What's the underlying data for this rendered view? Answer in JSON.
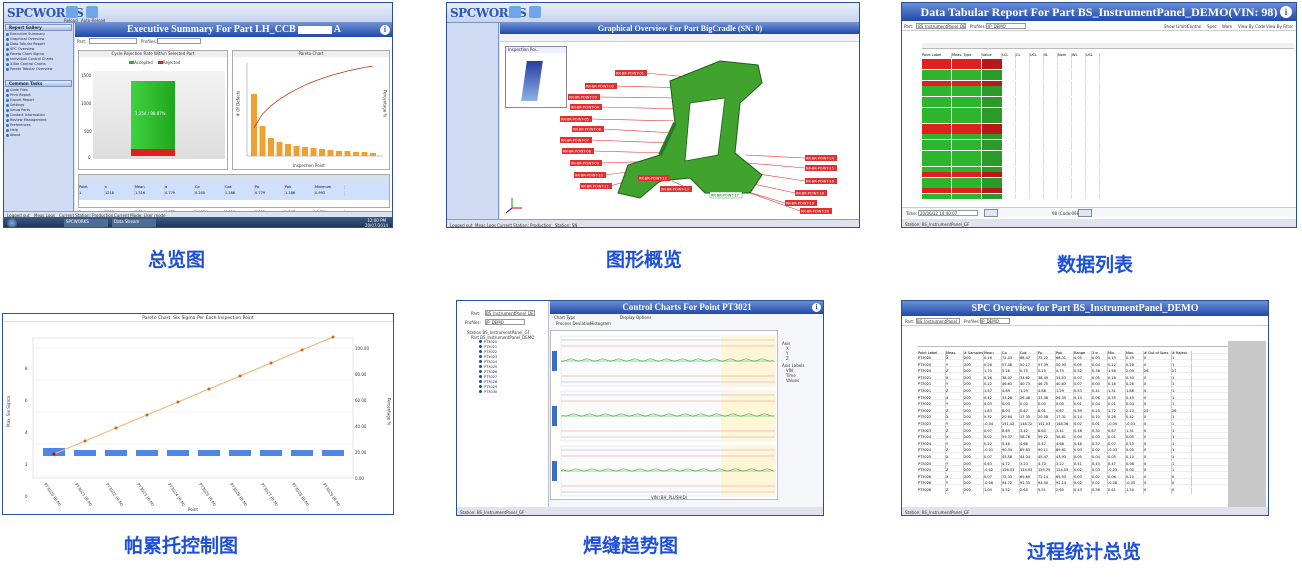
{
  "captions": [
    "总览图",
    "图形概览",
    "数据列表",
    "帕累托控制图",
    "焊缝趋势图",
    "过程统计总览"
  ],
  "logo_text": "SPCWORKS",
  "colors": {
    "caption": "#1d4fd8",
    "title_bar": "#2b56b5",
    "green": "#2db52d",
    "red": "#e02020",
    "orange": "#f08a1a",
    "blue_bar": "#4d86e6"
  },
  "tile1": {
    "title": "Executive Summary For Part LH_CCB",
    "title_suffix": "A",
    "toolbar": [
      "Reload",
      "Auto-Reload"
    ],
    "part_label": "Part:",
    "profiles_label": "Profiles:",
    "report_gallery": "Report Gallery",
    "side_items": [
      "Executive Summary",
      "Graphical Overview",
      "Data Tabular Report",
      "SPC Overview",
      "Pareto Chart Sigma",
      "Individual Control Charts",
      "X-Bar Control Charts",
      "Pareto Tabular Overview"
    ],
    "common_tasks": "Common Tasks",
    "task_items": [
      "Code Files",
      "Print Report",
      "Export Report",
      "Settings",
      "Setup Parts",
      "Contact Information",
      "Review Management",
      "Preferences",
      "Help",
      "About"
    ],
    "chart1_title": "Cycle Rejection Rate Within Selected Part",
    "chart1_legend": [
      "Accepted",
      "Rejected"
    ],
    "chart1_label": "1,254 / 98.87%",
    "chart2_title": "Pareto Chart",
    "chart2_ylabel": "# Of Defects",
    "chart2_xlabel": "Inspection Point",
    "chart2_right": "Percentage %",
    "y_ticks": [
      "1500",
      "1000",
      "500",
      "0"
    ],
    "table_headers": [
      "Point",
      "n",
      "Mean",
      "σ",
      "Cp",
      "Cpk",
      "Pp",
      "Ppk",
      "Minimum"
    ],
    "table_rows": [
      [
        "1",
        "1218",
        "1.316",
        "0.779",
        "0.200",
        "1.186",
        "0.779",
        "1.186",
        "0.993"
      ],
      [
        "2",
        "1218",
        "1.754",
        "0.475",
        "0.418",
        "1.416",
        "0.495",
        "1.367",
        "-0.009"
      ]
    ],
    "status": [
      "Logged out",
      "Meas Logs",
      "Current Station: Production",
      "Current Mode: User mode"
    ],
    "taskbar": [
      "SPCWORKS",
      "Data Stream"
    ],
    "clock": [
      "12:00 PM",
      "20/07/2014"
    ]
  },
  "tile2": {
    "title": "Graphical Overview For Part BigCradle (SN: 0)",
    "toolbar": [
      "Reload",
      "Auto-Reload"
    ],
    "part_label": "Part:",
    "part_value": "BigCradle",
    "profile_value": "SN",
    "popup_title": "Inspection Poi...",
    "labels_left": [
      "RR-BR-POINT-01",
      "RR-BR-POINT-02",
      "RR-BR-POINT-03",
      "RR-BR-POINT-04",
      "RR-BR-POINT-05",
      "RR-BR-POINT-06",
      "RR-BR-POINT-07",
      "RR-BR-POINT-08",
      "RR-BR-POINT-09",
      "RR-BR-POINT-10",
      "RR-BR-POINT-11",
      "RR-BR-POINT-12",
      "RR-BR-POINT-13"
    ],
    "labels_right": [
      "RR-BR-POINT-14",
      "RR-BR-POINT-15",
      "RR-BR-POINT-16",
      "RR-BR-POINT-17",
      "RR-BR-POINT-18",
      "RR-BR-POINT-19",
      "RR-BR-POINT-20"
    ],
    "status": [
      "Logged out",
      "Meas Logs",
      "Current Station: Production",
      "Station: SN"
    ]
  },
  "tile3": {
    "title": "Data Tabular Report For Part BS_InstrumentPanel_DEMO(VIN: 98)",
    "part_label": "Part:",
    "part_value": "BS_InstrumentPanel_DEMO",
    "profiles_label": "Profiles:",
    "profiles_value": "IP_DEMO",
    "show_limits": "Show Limits",
    "checks": [
      "Control",
      "Spec",
      "Warn"
    ],
    "view_by": [
      "View By Code",
      "View By Filter"
    ],
    "headers": [
      "Point Label",
      "Meas. Type",
      "Value",
      "LCL",
      "CL",
      "UCL",
      "SL",
      "Nom",
      "WL",
      "USL"
    ],
    "row_statuses": [
      "r",
      "r",
      "g",
      "g",
      "r",
      "g",
      "g",
      "g",
      "g",
      "g",
      "g",
      "g",
      "r",
      "r",
      "g",
      "g",
      "g",
      "g",
      "g",
      "g",
      "g",
      "r",
      "g",
      "g",
      "r",
      "g"
    ],
    "time_label": "Time:",
    "time_value": "20/06/12 14:40:07",
    "vin_label": "98 (Code:098)",
    "status": "Station: BS_InstrumentPanel_GF"
  },
  "tile4": {
    "title": "Pareto Chart: Six Sigma Per Each Inspection Point",
    "legend": [
      "Max. Six Sigma",
      "Cumulative Pareto Line"
    ],
    "xlabel": "Point",
    "ylabel_left": "Max. Six Sigma",
    "ylabel_right": "Percentage %",
    "y_ticks": [
      "8",
      "6",
      "4",
      "2",
      "0"
    ],
    "right_ticks": [
      "100.00",
      "80.00",
      "60.00",
      "40.00",
      "20.00",
      "0.00"
    ],
    "points": [
      "PT3020 (R-M)",
      "PT3021 (R-M)",
      "PT3022 (R-M)",
      "PT3023 (R-M)",
      "PT3024 (R-M)",
      "PT3025 (R-M)",
      "PT3026 (R-M)",
      "PT3027 (R-M)",
      "PT3028 (R-M)",
      "PT3029 (R-M)"
    ]
  },
  "tile5": {
    "title": "Control Charts For Point PT3021",
    "part_label": "Part:",
    "part_value": "BS_InstrumentPanel_DEMO",
    "profiles_label": "Profiles:",
    "profiles_value": "IP_DEMO",
    "tree_root": "Station BS_InstrumentPanel_GF",
    "tree_part": "Part BS_InstrumentPanel_DEMO",
    "tree_points": [
      "PT3020",
      "PT3021",
      "PT3022",
      "PT3023",
      "PT3024",
      "PT3025",
      "PT3026",
      "PT3027",
      "PT3028",
      "PT3029",
      "PT3030"
    ],
    "chart_type_label": "Chart Type",
    "chart_types": [
      "Process Deviation",
      "Histogram"
    ],
    "display_label": "Display Options",
    "display_opts": [
      "Mean",
      "Std.Dev.",
      "Warn",
      "Spec",
      "Control",
      "Cp",
      "Cpk",
      "Pp",
      "Ppk",
      "Def Curve"
    ],
    "axis_label": "Axis",
    "axis_opts": [
      "X",
      "Y",
      "Z"
    ],
    "axis_labels_label": "Axis Labels",
    "axis_label_opts": [
      "VIN",
      "Time",
      "Values"
    ],
    "xlabel": "VIN (BH_PLUSHID)",
    "status": "Station: BS_InstrumentPanel_GF"
  },
  "tile6": {
    "title": "SPC Overview for Part BS_InstrumentPanel_DEMO",
    "part_label": "Part:",
    "part_value": "BS_InstrumentPanel_DEMO",
    "profiles_label": "Profiles:",
    "profiles_value": "IP_DEMO",
    "headers": [
      "Point Label",
      "Meas. Type",
      "# Samples",
      "Mean",
      "Cp",
      "Cpk",
      "Pp",
      "Ppk",
      "Range",
      "3 σ",
      "Min.",
      "Max.",
      "# Out of Spec",
      "# Reject"
    ],
    "rows": [
      [
        "PT3020",
        "X",
        "200",
        "0.16",
        "72.43",
        "68.47",
        "72.22",
        "66.31",
        "0.05",
        "0.03",
        "0.13",
        "0.19",
        "0",
        "1"
      ],
      [
        "PT3020",
        "Y",
        "200",
        "0.26",
        "57.48",
        "50.17",
        "57.39",
        "50.93",
        "0.05",
        "0.04",
        "0.22",
        "0.28",
        "0",
        "1"
      ],
      [
        "PT3020",
        "Z",
        "200",
        "1.70",
        "5.28",
        "0.75",
        "5.25",
        "0.75",
        "0.52",
        "0.38",
        "1.56",
        "2.09",
        "26",
        "27"
      ],
      [
        "PT3021",
        "X",
        "200",
        "0.26",
        "38.07",
        "34.62",
        "38.49",
        "34.53",
        "0.07",
        "0.05",
        "0.18",
        "0.30",
        "0",
        "1"
      ],
      [
        "PT3021",
        "Y",
        "200",
        "0.22",
        "46.63",
        "40.73",
        "46.75",
        "40.63",
        "0.07",
        "0.04",
        "0.18",
        "0.26",
        "0",
        "1"
      ],
      [
        "PT3021",
        "Z",
        "200",
        "1.47",
        "4.89",
        "1.29",
        "4.88",
        "1.29",
        "0.53",
        "0.41",
        "1.31",
        "1.86",
        "0",
        "1"
      ],
      [
        "PT3022",
        "X",
        "200",
        "0.42",
        "33.28",
        "26.48",
        "33.38",
        "26.35",
        "0.10",
        "0.06",
        "0.35",
        "0.49",
        "0",
        "1"
      ],
      [
        "PT3022",
        "Y",
        "200",
        "0.03",
        "0.00",
        "0.00",
        "0.00",
        "0.00",
        "0.01",
        "0.04",
        "0.01",
        "0.04",
        "0",
        "1"
      ],
      [
        "PT3022",
        "Z",
        "200",
        "1.83",
        "8.03",
        "0.67",
        "8.01",
        "0.67",
        "0.39",
        "0.25",
        "1.72",
        "2.10",
        "25",
        "26"
      ],
      [
        "PT3023",
        "X",
        "200",
        "0.32",
        "20.64",
        "17.35",
        "20.58",
        "17.31",
        "0.14",
        "0.10",
        "0.26",
        "0.42",
        "0",
        "1"
      ],
      [
        "PT3023",
        "Y",
        "200",
        "-0.04",
        "151.42",
        "148.72",
        "151.03",
        "148.36",
        "0.02",
        "0.01",
        "-0.05",
        "-0.03",
        "0",
        "1"
      ],
      [
        "PT3023",
        "Z",
        "200",
        "0.97",
        "8.65",
        "3.42",
        "8.64",
        "3.41",
        "0.46",
        "0.30",
        "0.67",
        "1.31",
        "0",
        "1"
      ],
      [
        "PT3024",
        "X",
        "200",
        "0.02",
        "59.37",
        "58.76",
        "59.22",
        "58.61",
        "0.04",
        "0.03",
        "0.01",
        "0.05",
        "0",
        "1"
      ],
      [
        "PT3024",
        "Y",
        "200",
        "0.22",
        "5.46",
        "4.66",
        "5.47",
        "4.68",
        "0.46",
        "0.37",
        "0.07",
        "0.53",
        "0",
        "1"
      ],
      [
        "PT3024",
        "Z",
        "200",
        "-0.01",
        "90.34",
        "89.83",
        "90.11",
        "89.61",
        "0.03",
        "0.02",
        "-0.03",
        "0.00",
        "0",
        "1"
      ],
      [
        "PT3025",
        "X",
        "200",
        "0.07",
        "45.58",
        "44.04",
        "45.47",
        "43.93",
        "0.05",
        "0.04",
        "0.05",
        "0.10",
        "0",
        "1"
      ],
      [
        "PT3025",
        "Y",
        "200",
        "0.63",
        "4.72",
        "3.23",
        "4.70",
        "3.22",
        "0.51",
        "0.43",
        "0.47",
        "0.98",
        "0",
        "1"
      ],
      [
        "PT3025",
        "Z",
        "200",
        "-0.02",
        "126.03",
        "124.93",
        "125.75",
        "124.55",
        "0.02",
        "0.03",
        "-0.03",
        "0.00",
        "0",
        "1"
      ],
      [
        "PT3026",
        "X",
        "200",
        "0.07",
        "72.33",
        "69.69",
        "72.14",
        "69.53",
        "0.03",
        "0.02",
        "0.06",
        "0.10",
        "0",
        "0"
      ],
      [
        "PT3026",
        "Y",
        "200",
        "-0.06",
        "94.72",
        "92.35",
        "94.50",
        "92.14",
        "0.02",
        "0.02",
        "-0.08",
        "-0.05",
        "0",
        "0"
      ],
      [
        "PT3026",
        "Z",
        "200",
        "1.04",
        "5.52",
        "2.65",
        "5.51",
        "2.65",
        "0.43",
        "0.36",
        "0.61",
        "1.34",
        "0",
        "0"
      ]
    ],
    "status": "Station: BS_InstrumentPanel_GF"
  }
}
